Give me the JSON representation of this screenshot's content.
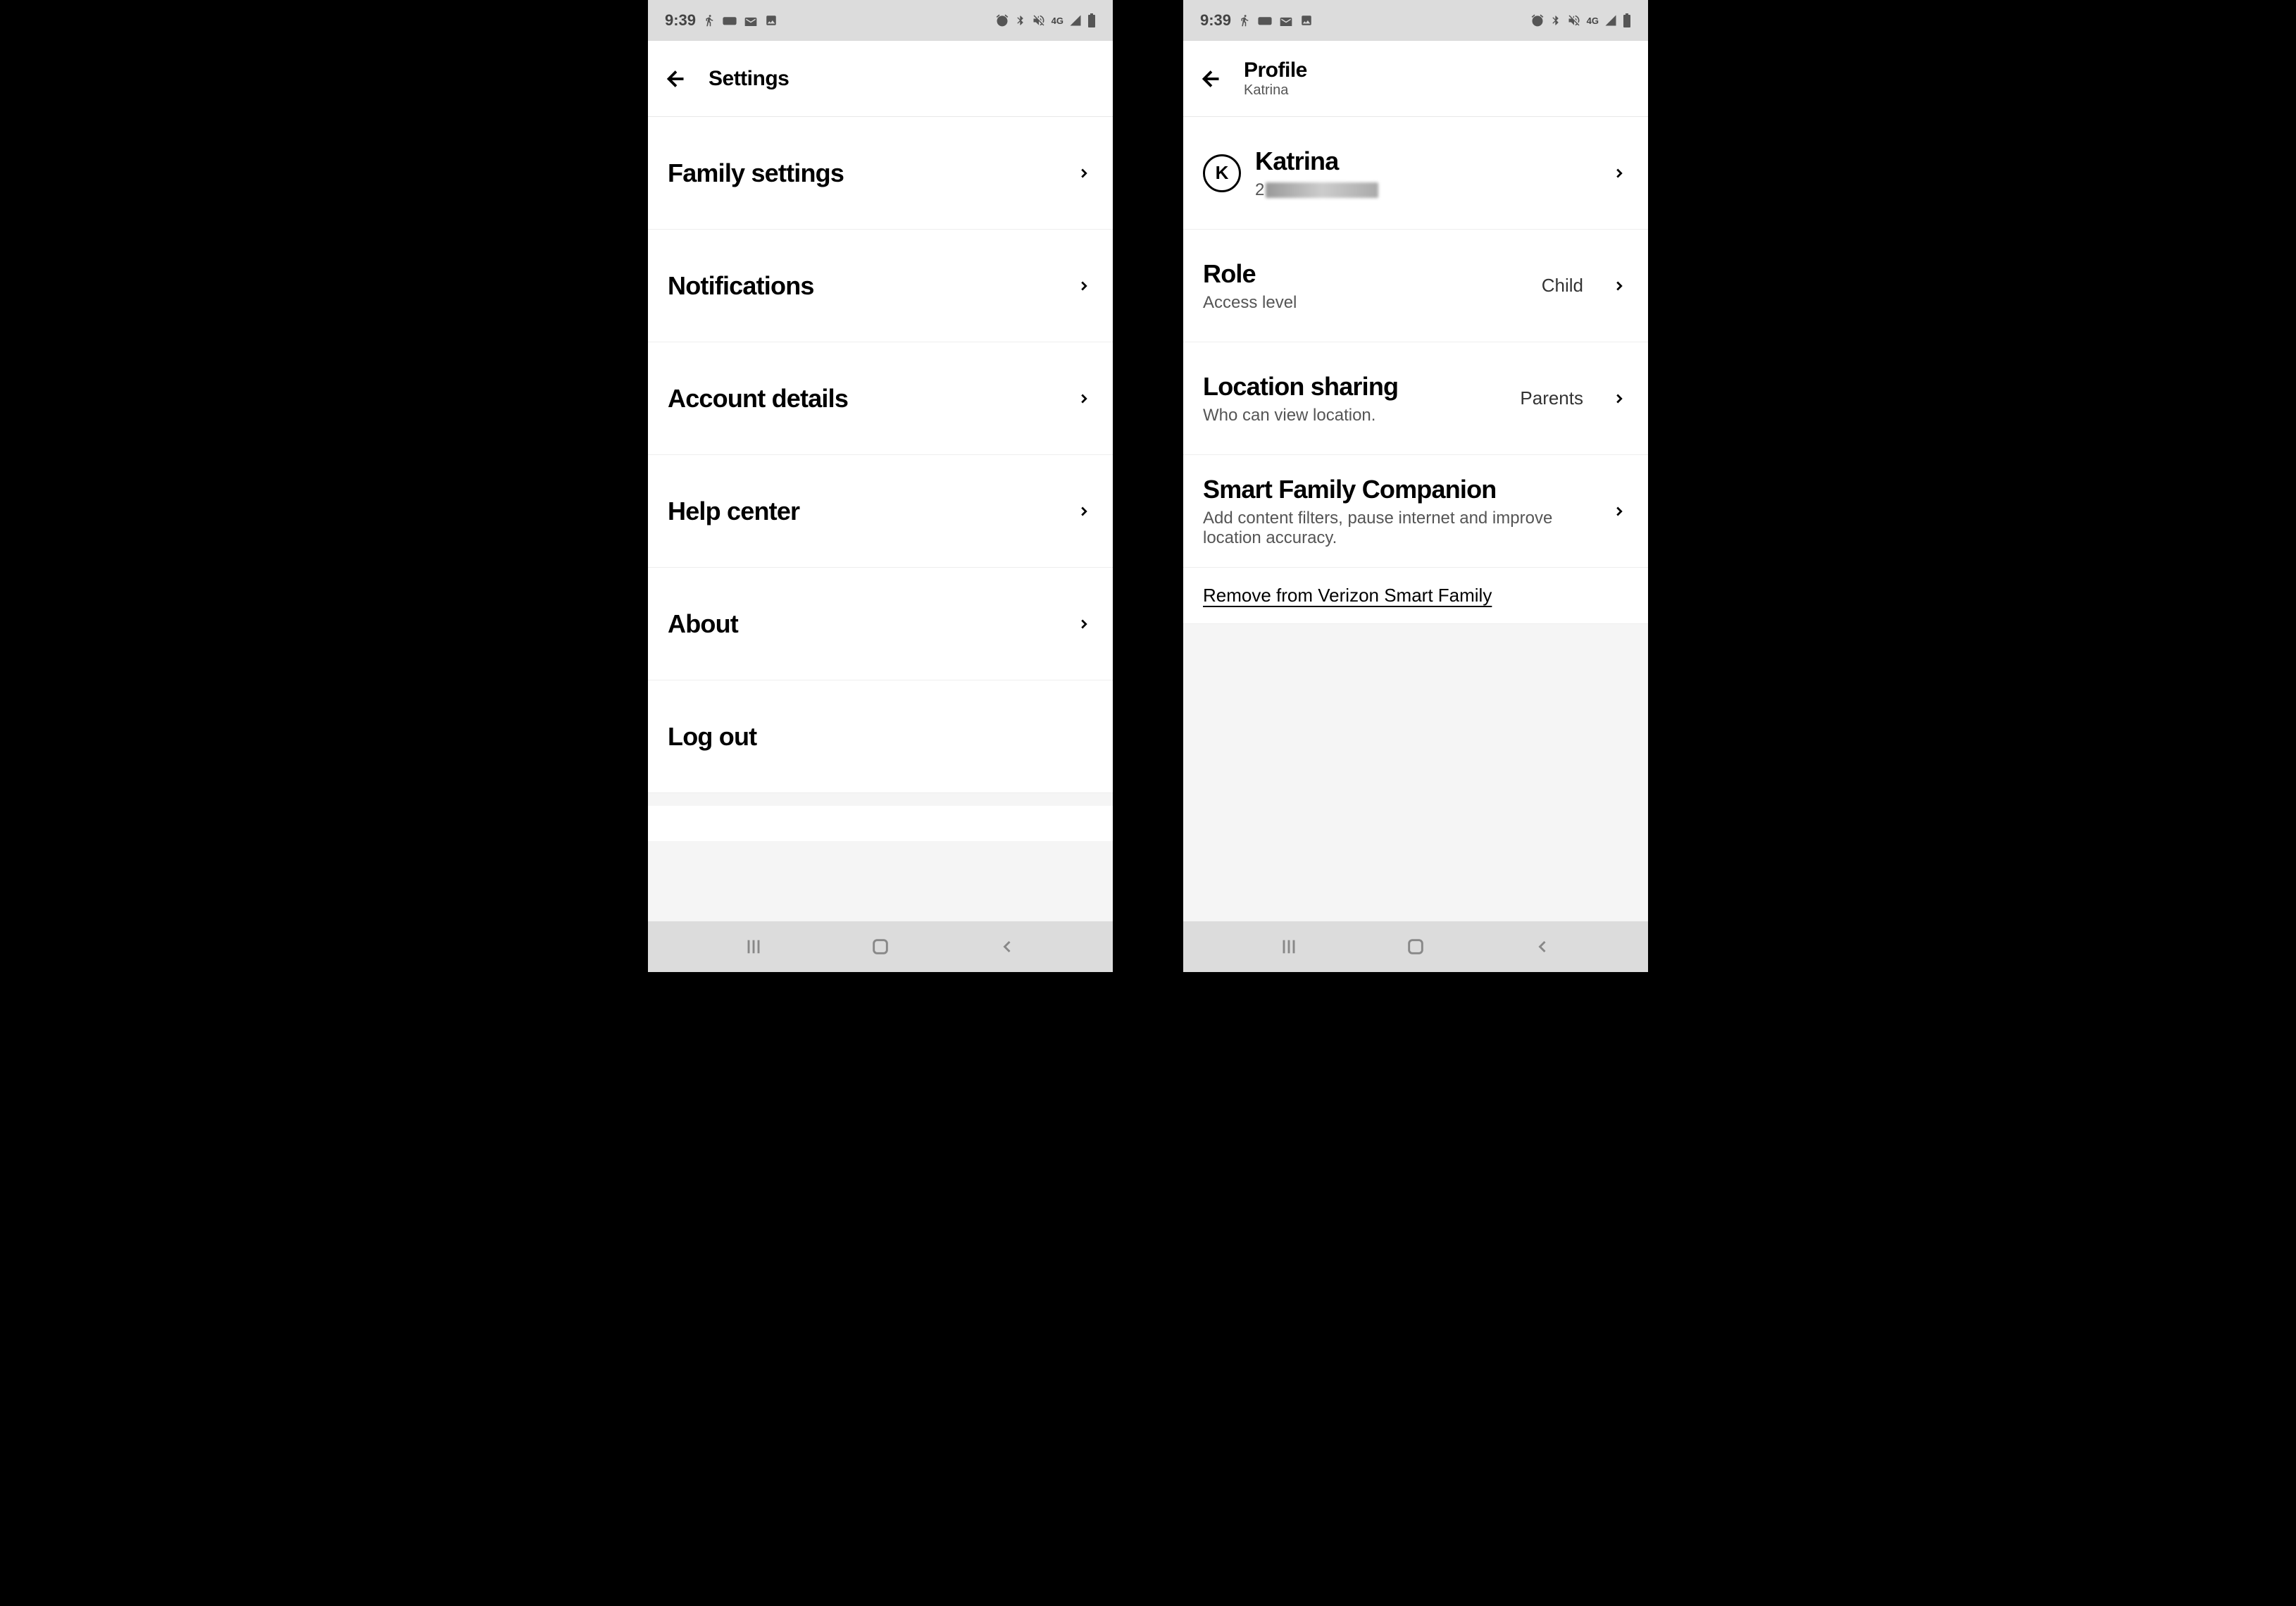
{
  "statusBar": {
    "time": "9:39",
    "icons": {
      "left": [
        "activity",
        "vpn",
        "mail",
        "image"
      ],
      "right": [
        "alarm",
        "bluetooth",
        "mute",
        "4g",
        "signal",
        "battery"
      ]
    }
  },
  "screen1": {
    "header": {
      "title": "Settings"
    },
    "items": [
      {
        "title": "Family settings",
        "hasChevron": true
      },
      {
        "title": "Notifications",
        "hasChevron": true
      },
      {
        "title": "Account details",
        "hasChevron": true
      },
      {
        "title": "Help center",
        "hasChevron": true
      },
      {
        "title": "About",
        "hasChevron": true
      },
      {
        "title": "Log out",
        "hasChevron": false
      }
    ]
  },
  "screen2": {
    "header": {
      "title": "Profile",
      "subtitle": "Katrina"
    },
    "profile": {
      "avatarLetter": "K",
      "name": "Katrina",
      "phonePrefix": "2"
    },
    "items": [
      {
        "title": "Role",
        "subtitle": "Access level",
        "value": "Child"
      },
      {
        "title": "Location sharing",
        "subtitle": "Who can view location.",
        "value": "Parents"
      },
      {
        "title": "Smart Family Companion",
        "subtitle": "Add content filters, pause internet and improve location accuracy.",
        "value": ""
      }
    ],
    "removeLink": "Remove from Verizon Smart Family"
  }
}
